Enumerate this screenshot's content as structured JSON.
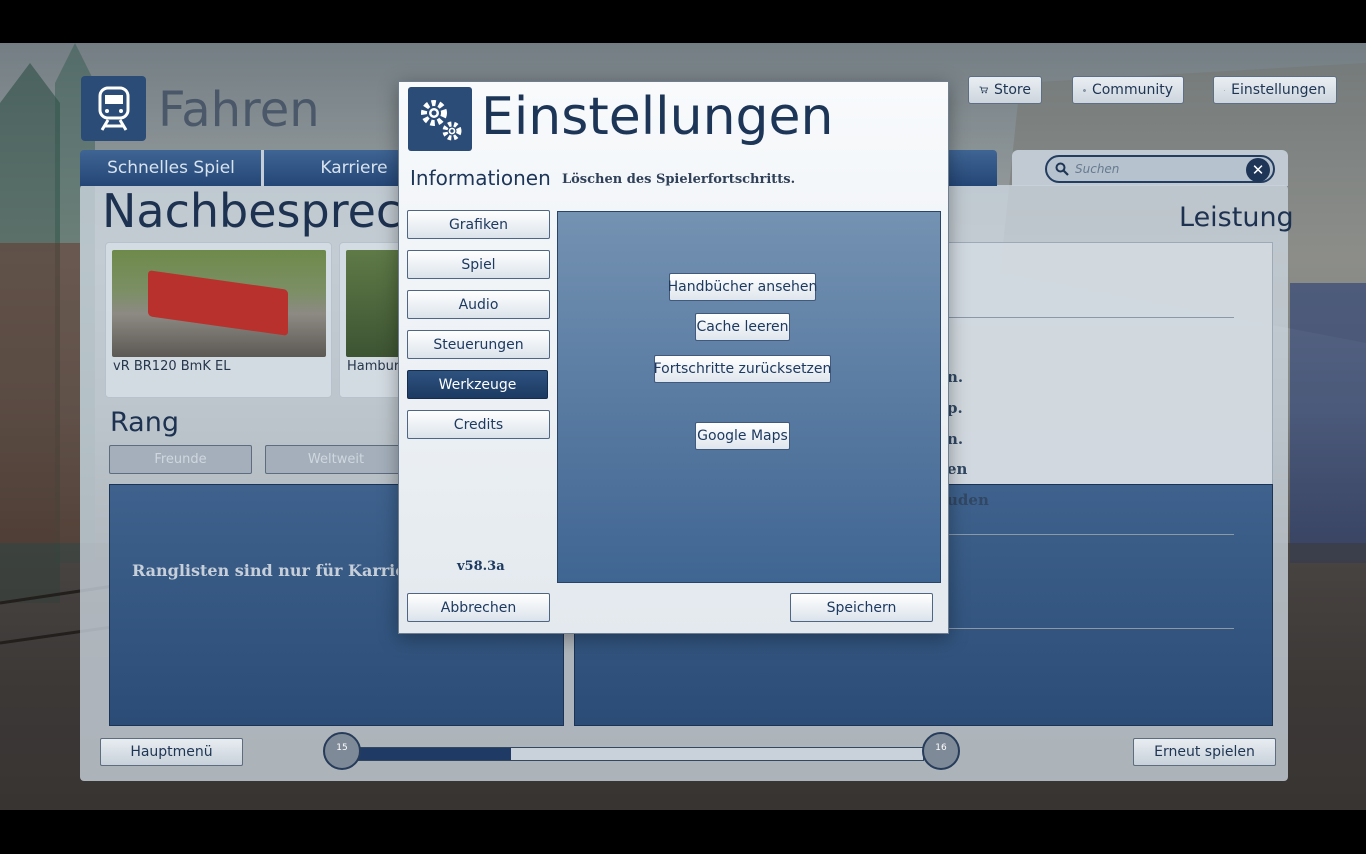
{
  "app": {
    "title": "Fahren"
  },
  "top_buttons": {
    "store": "Store",
    "community": "Community",
    "settings": "Einstellungen"
  },
  "tabs": [
    "Schnelles Spiel",
    "Karriere"
  ],
  "search": {
    "placeholder": "Suchen"
  },
  "page": {
    "heading": "Nachbesprech",
    "right_heading": "Leistung"
  },
  "cards": [
    {
      "caption": "vR BR120 BmK EL"
    },
    {
      "caption": "Hambur"
    }
  ],
  "rank": {
    "title": "Rang",
    "btn_friends": "Freunde",
    "btn_world": "Weltweit",
    "note": "Ranglisten sind nur für Karriere Sz"
  },
  "right_fragments": [
    "n.",
    "p.",
    "n.",
    "en",
    "uden"
  ],
  "bottom": {
    "main_menu": "Hauptmenü",
    "replay": "Erneut spielen",
    "level_start": "15",
    "level_end": "16",
    "progress": 0.27
  },
  "modal": {
    "title": "Einstellungen",
    "section": "Informationen",
    "subtitle": "Löschen des Spielerfortschritts.",
    "nav": [
      "Grafiken",
      "Spiel",
      "Audio",
      "Steuerungen",
      "Werkzeuge",
      "Credits"
    ],
    "active_nav": "Werkzeuge",
    "version": "v58.3a",
    "tools": {
      "manuals": "Handbücher ansehen",
      "cache": "Cache leeren",
      "reset": "Fortschritte zurücksetzen",
      "maps": "Google Maps"
    },
    "cancel": "Abbrechen",
    "save": "Speichern"
  },
  "colors": {
    "accent": "#2a4c77",
    "panel_dark": "#2b4c76",
    "active_nav": "#1c3a62"
  }
}
